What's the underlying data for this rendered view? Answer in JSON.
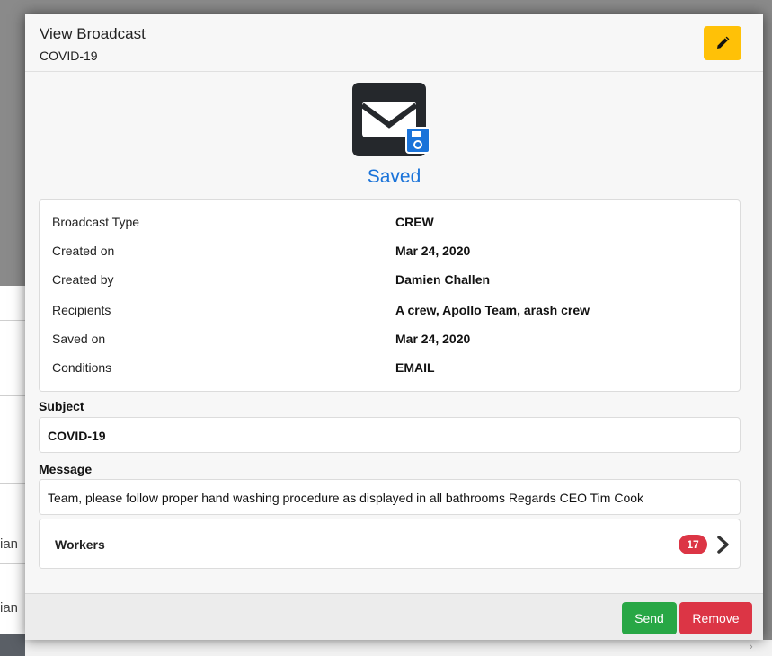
{
  "background": {
    "fragment_1": "ian",
    "fragment_2": "ian"
  },
  "header": {
    "title": "View Broadcast",
    "subtitle": "COVID-19",
    "edit_icon": "pencil-icon"
  },
  "status": {
    "icon": "envelope-saved-icon",
    "label": "Saved"
  },
  "details": [
    {
      "label": "Broadcast Type",
      "value": "CREW"
    },
    {
      "label": "Created on",
      "value": "Mar 24, 2020"
    },
    {
      "label": "Created by",
      "value": "Damien Challen"
    },
    {
      "label": "Recipients",
      "value": "A crew, Apollo Team, arash crew"
    },
    {
      "label": "Saved on",
      "value": "Mar 24, 2020"
    },
    {
      "label": "Conditions",
      "value": "EMAIL"
    }
  ],
  "subject": {
    "label": "Subject",
    "value": "COVID-19"
  },
  "message": {
    "label": "Message",
    "value": "Team, please follow proper hand washing procedure as displayed in all bathrooms Regards CEO Tim Cook"
  },
  "workers": {
    "label": "Workers",
    "count": "17"
  },
  "footer": {
    "send_label": "Send",
    "remove_label": "Remove"
  },
  "colors": {
    "accent_blue": "#1a73d9",
    "edit_yellow": "#ffc107",
    "send_green": "#28a745",
    "remove_red": "#dc3545"
  }
}
